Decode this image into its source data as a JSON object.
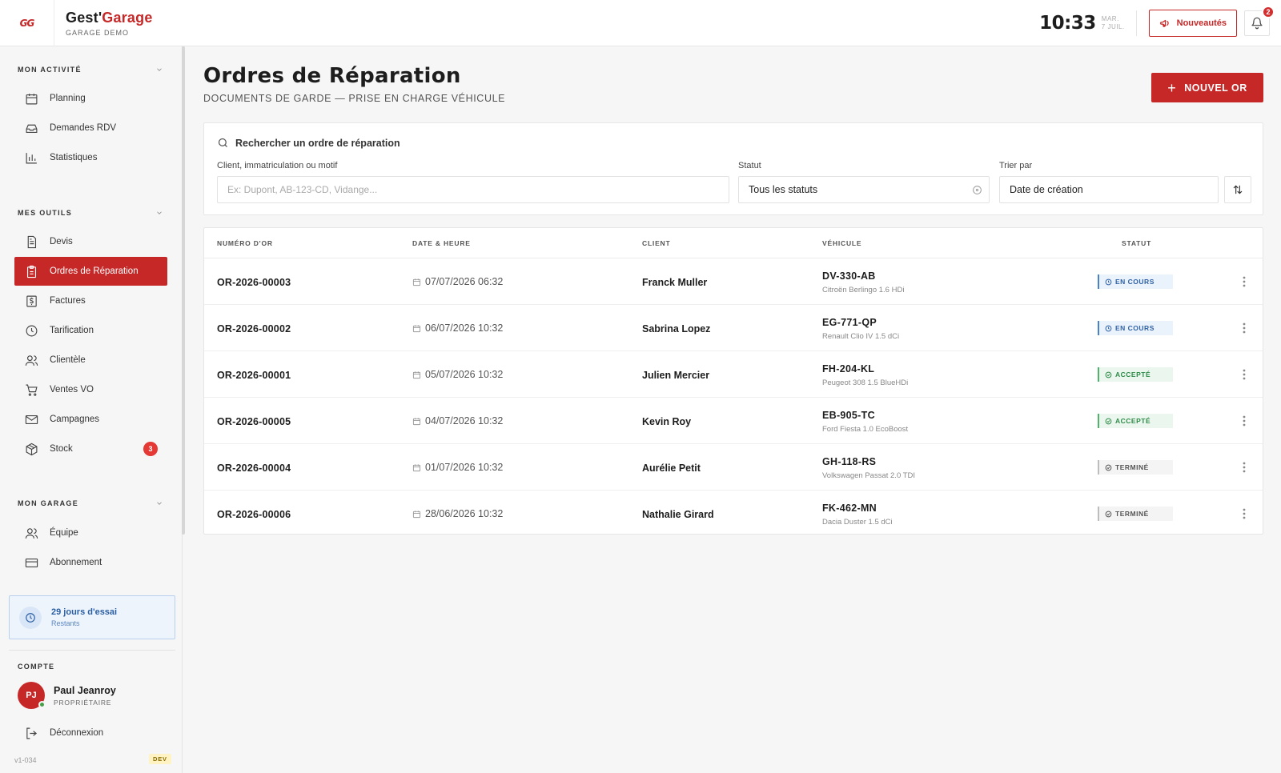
{
  "header": {
    "logo_text": "GG",
    "brand_prefix": "Gest'",
    "brand_accent": "Garage",
    "subtitle": "GARAGE DEMO",
    "time": "10:33",
    "day": "MAR.",
    "date": "7 JUIL.",
    "news_button": "Nouveautés",
    "notification_count": "2"
  },
  "sidebar": {
    "section_activity": "MON ACTIVITÉ",
    "activity_items": [
      {
        "label": "Planning",
        "icon": "calendar-icon"
      },
      {
        "label": "Demandes RDV",
        "icon": "inbox-icon"
      },
      {
        "label": "Statistiques",
        "icon": "bar-chart-icon"
      }
    ],
    "section_tools": "MES OUTILS",
    "tools_items": [
      {
        "label": "Devis",
        "icon": "document-icon"
      },
      {
        "label": "Ordres de Réparation",
        "icon": "clipboard-icon",
        "active": true
      },
      {
        "label": "Factures",
        "icon": "dollar-icon"
      },
      {
        "label": "Tarification",
        "icon": "clock-icon"
      },
      {
        "label": "Clientèle",
        "icon": "users-icon"
      },
      {
        "label": "Ventes VO",
        "icon": "cart-icon"
      },
      {
        "label": "Campagnes",
        "icon": "mail-icon"
      },
      {
        "label": "Stock",
        "icon": "box-icon",
        "badge": "3"
      }
    ],
    "section_garage": "MON GARAGE",
    "garage_items": [
      {
        "label": "Équipe",
        "icon": "team-icon"
      },
      {
        "label": "Abonnement",
        "icon": "credit-card-icon"
      }
    ],
    "trial": {
      "title": "29 jours d'essai",
      "subtitle": "Restants"
    },
    "section_account": "COMPTE",
    "account": {
      "initials": "PJ",
      "name": "Paul Jeanroy",
      "role": "PROPRIÉTAIRE"
    },
    "logout_label": "Déconnexion",
    "version": "v1-034",
    "env_tag": "DEV"
  },
  "main": {
    "title": "Ordres de Réparation",
    "subtitle": "DOCUMENTS DE GARDE — PRISE EN CHARGE VÉHICULE",
    "new_button": "NOUVEL OR",
    "search": {
      "heading": "Rechercher un ordre de réparation",
      "query_label": "Client, immatriculation ou motif",
      "query_placeholder": "Ex: Dupont, AB-123-CD, Vidange...",
      "status_label": "Statut",
      "status_value": "Tous les statuts",
      "sort_label": "Trier par",
      "sort_value": "Date de création"
    },
    "table": {
      "columns": [
        "NUMÉRO D'OR",
        "DATE & HEURE",
        "CLIENT",
        "VÉHICULE",
        "STATUT"
      ],
      "rows": [
        {
          "or": "OR-2026-00003",
          "date": "07/07/2026 06:32",
          "client": "Franck Muller",
          "plate": "DV-330-AB",
          "model": "Citroën Berlingo 1.6 HDi",
          "status": "EN COURS",
          "status_kind": "cours"
        },
        {
          "or": "OR-2026-00002",
          "date": "06/07/2026 10:32",
          "client": "Sabrina Lopez",
          "plate": "EG-771-QP",
          "model": "Renault Clio IV 1.5 dCi",
          "status": "EN COURS",
          "status_kind": "cours"
        },
        {
          "or": "OR-2026-00001",
          "date": "05/07/2026 10:32",
          "client": "Julien Mercier",
          "plate": "FH-204-KL",
          "model": "Peugeot 308 1.5 BlueHDi",
          "status": "ACCEPTÉ",
          "status_kind": "accept"
        },
        {
          "or": "OR-2026-00005",
          "date": "04/07/2026 10:32",
          "client": "Kevin Roy",
          "plate": "EB-905-TC",
          "model": "Ford Fiesta 1.0 EcoBoost",
          "status": "ACCEPTÉ",
          "status_kind": "accept"
        },
        {
          "or": "OR-2026-00004",
          "date": "01/07/2026 10:32",
          "client": "Aurélie Petit",
          "plate": "GH-118-RS",
          "model": "Volkswagen Passat 2.0 TDI",
          "status": "TERMINÉ",
          "status_kind": "termine"
        },
        {
          "or": "OR-2026-00006",
          "date": "28/06/2026 10:32",
          "client": "Nathalie Girard",
          "plate": "FK-462-MN",
          "model": "Dacia Duster 1.5 dCi",
          "status": "TERMINÉ",
          "status_kind": "termine"
        }
      ]
    }
  },
  "colors": {
    "accent": "#c62828",
    "status_in_progress": "#2f62a6",
    "status_accepted": "#2e8b48",
    "status_done": "#555555"
  }
}
